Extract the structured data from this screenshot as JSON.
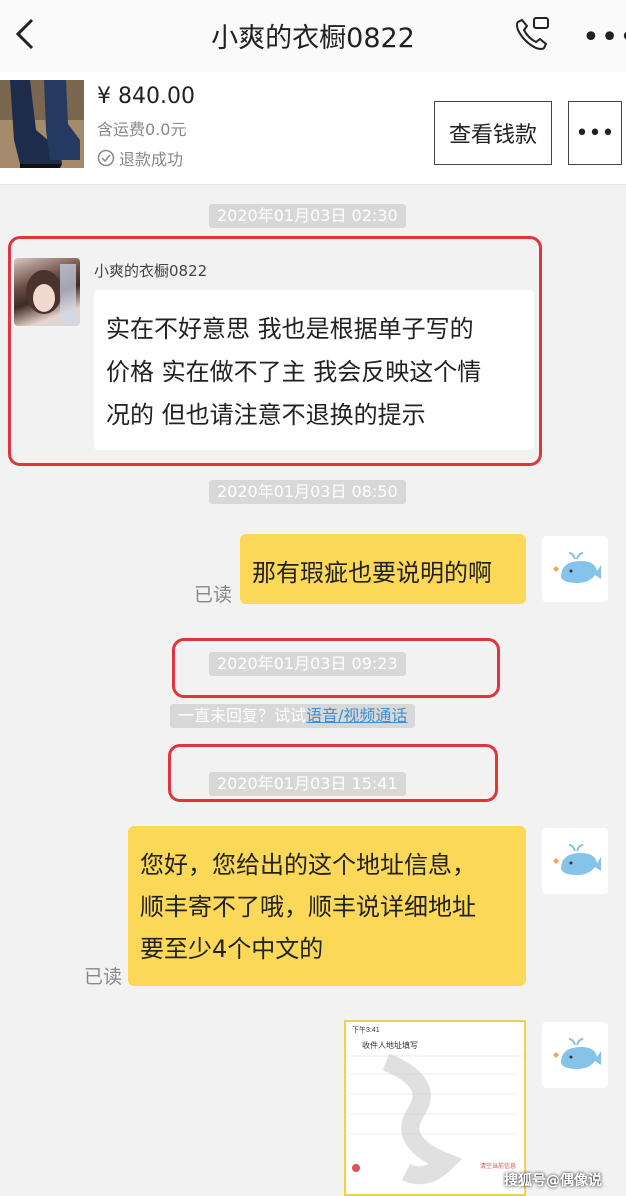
{
  "header": {
    "title": "小爽的衣橱0822",
    "more": "•••"
  },
  "product": {
    "price": "¥ 840.00",
    "shipping": "含运费0.0元",
    "refund_status": "退款成功",
    "view_button": "查看钱款",
    "more_button": "•••"
  },
  "messages": {
    "time1": "2020年01月03日 02:30",
    "sender_name": "小爽的衣橱0822",
    "msg1_line1": "实在不好意思 我也是根据单子写的",
    "msg1_line2": "价格 实在做不了主 我会反映这个情",
    "msg1_line3": "况的 但也请注意不退换的提示",
    "time2": "2020年01月03日 08:50",
    "msg2": "那有瑕疵也要说明的啊",
    "read1": "已读",
    "time3": "2020年01月03日 09:23",
    "notice_prefix": "一直未回复？试试",
    "notice_link": "语音/视频通话",
    "time4": "2020年01月03日 15:41",
    "msg3_line1": "您好，您给出的这个地址信息，",
    "msg3_line2": "顺丰寄不了哦，顺丰说详细地址",
    "msg3_line3": "要至少4个中文的",
    "read2": "已读"
  },
  "thumbnail": {
    "status_time": "下午3:41",
    "title": "收件人地址填写",
    "bottom_link": "清空当前信息"
  },
  "watermark": "搜狐号@偶像说",
  "colors": {
    "bubble_yellow": "#fbd857",
    "highlight_red": "#e0353b",
    "link_blue": "#3d8fd6"
  }
}
